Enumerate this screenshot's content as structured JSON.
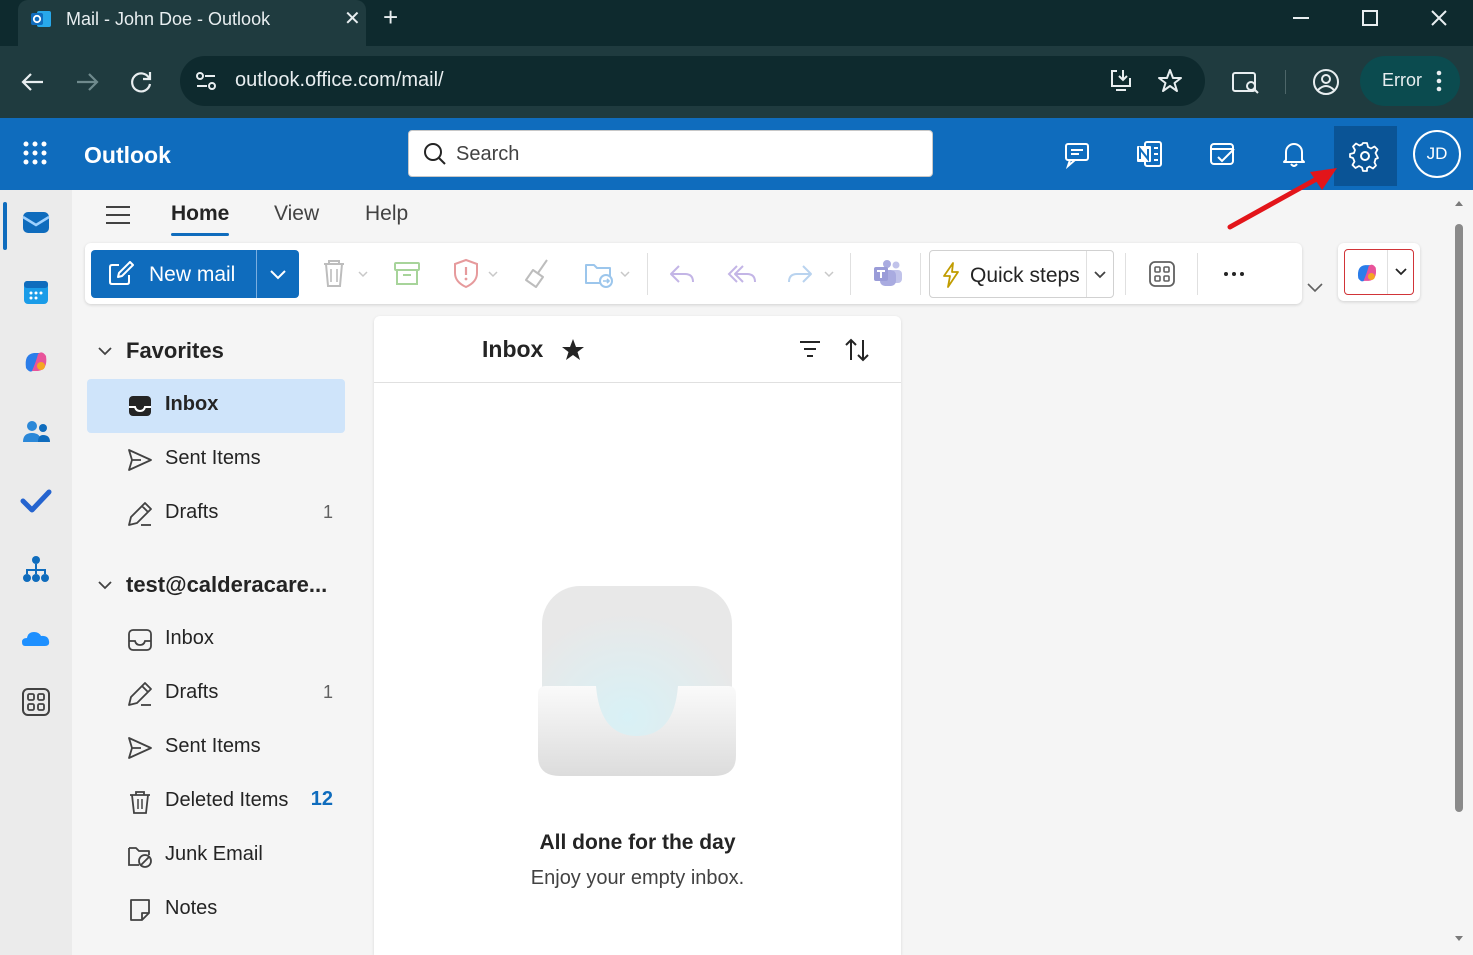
{
  "browser": {
    "tab_title": "Mail - John Doe - Outlook",
    "url": "outlook.office.com/mail/",
    "profile_status": "Error"
  },
  "outlook": {
    "brand": "Outlook",
    "search_placeholder": "Search",
    "avatar_initials": "JD",
    "accent_color": "#0f6cbd"
  },
  "ribbon": {
    "tabs": [
      "Home",
      "View",
      "Help"
    ],
    "active_tab": "Home",
    "new_mail_label": "New mail",
    "quick_steps_label": "Quick steps"
  },
  "folders": {
    "favorites": {
      "title": "Favorites",
      "items": [
        {
          "label": "Inbox",
          "icon": "inbox-icon",
          "count": "",
          "selected": true
        },
        {
          "label": "Sent Items",
          "icon": "send-icon",
          "count": ""
        },
        {
          "label": "Drafts",
          "icon": "drafts-icon",
          "count": "1"
        }
      ]
    },
    "account": {
      "title": "test@calderacare...",
      "items": [
        {
          "label": "Inbox",
          "icon": "inbox-icon",
          "count": ""
        },
        {
          "label": "Drafts",
          "icon": "drafts-icon",
          "count": "1"
        },
        {
          "label": "Sent Items",
          "icon": "send-icon",
          "count": ""
        },
        {
          "label": "Deleted Items",
          "icon": "trash-icon",
          "count": "12"
        },
        {
          "label": "Junk Email",
          "icon": "junk-icon",
          "count": ""
        },
        {
          "label": "Notes",
          "icon": "notes-icon",
          "count": ""
        }
      ]
    }
  },
  "message_list": {
    "title": "Inbox",
    "empty_title": "All done for the day",
    "empty_subtitle": "Enjoy your empty inbox."
  }
}
